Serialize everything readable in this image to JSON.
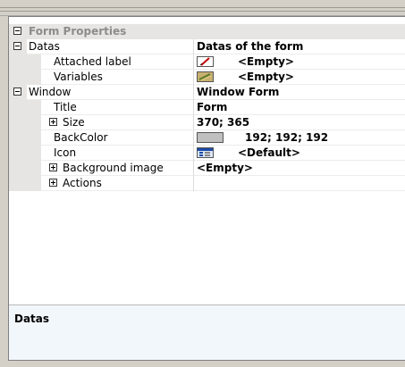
{
  "panel": {
    "header": "Form Properties",
    "rows": [
      {
        "name": "Datas",
        "value": "Datas of the form"
      },
      {
        "name": "Attached label",
        "value": "<Empty>"
      },
      {
        "name": "Variables",
        "value": "<Empty>"
      },
      {
        "name": "Window",
        "value": "Window Form"
      },
      {
        "name": "Title",
        "value": "Form"
      },
      {
        "name": "Size",
        "value": "370; 365"
      },
      {
        "name": "BackColor",
        "value": "192; 192; 192"
      },
      {
        "name": "Icon",
        "value": "<Default>"
      },
      {
        "name": "Background image",
        "value": "<Empty>"
      },
      {
        "name": "Actions",
        "value": ""
      }
    ],
    "backcolor_swatch": "#c0c0c0",
    "icons": {
      "attached_label": "label-pencil-icon",
      "variables": "variables-icon",
      "icon": "form-window-icon"
    }
  },
  "description": {
    "title": "Datas"
  }
}
